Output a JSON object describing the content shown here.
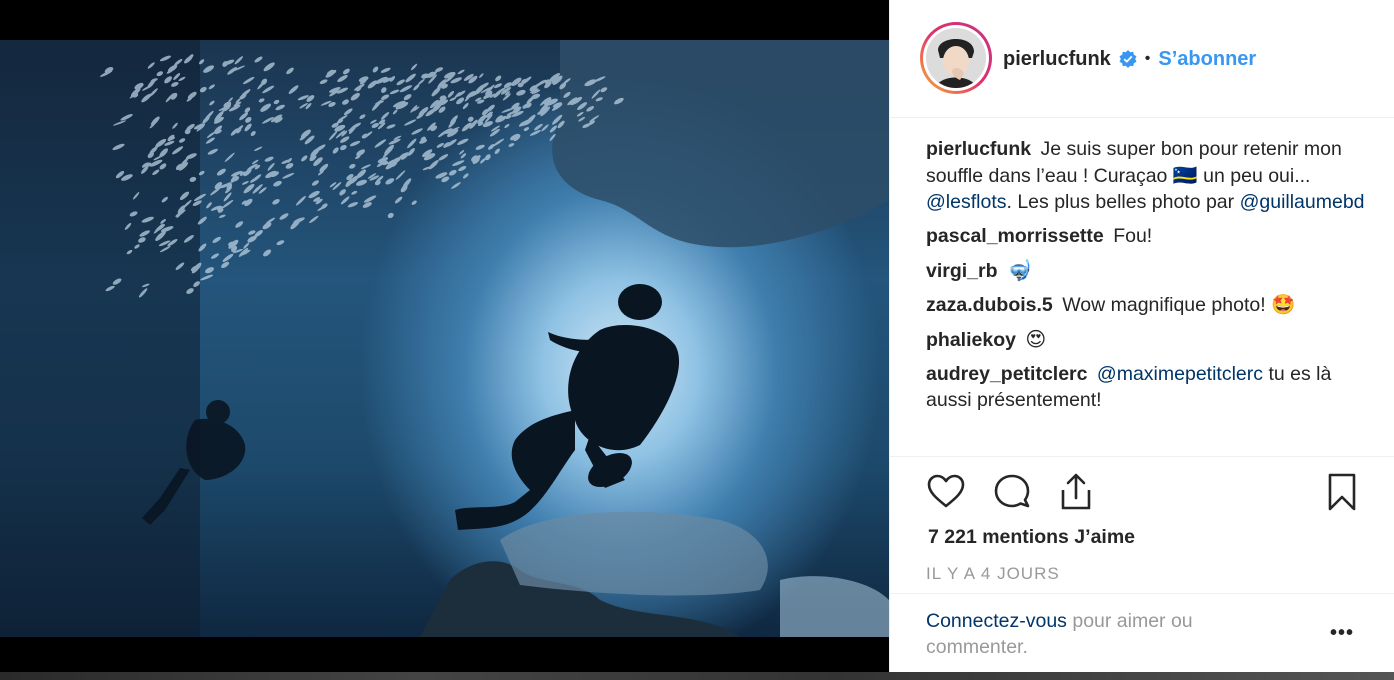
{
  "post": {
    "author": "pierlucfunk",
    "follow_label": "S’abonner",
    "dot": "•",
    "likes": "7 221 mentions J’aime",
    "time": "IL Y A 4 JOURS"
  },
  "caption": {
    "user": "pierlucfunk",
    "text_1": "Je suis super bon pour retenir mon souffle dans l’eau ! Curaçao",
    "flag_emoji": "🇨🇼",
    "text_2": "un peu oui...",
    "mention_1": "@lesflots",
    "text_3": ". Les plus belles photo par",
    "mention_2": "@guillaumebd"
  },
  "comments": [
    {
      "user": "pascal_morrissette",
      "text": "Fou!"
    },
    {
      "user": "virgi_rb",
      "text": "🤿"
    },
    {
      "user": "zaza.dubois.5",
      "text": "Wow magnifique photo! 🤩"
    },
    {
      "user": "phaliekoy",
      "text": "😍"
    },
    {
      "user": "audrey_petitclerc",
      "mention": "@maximepetitclerc",
      "text": "tu es là aussi présentement!"
    }
  ],
  "login": {
    "link": "Connectez-vous",
    "text": "pour aimer ou commenter."
  },
  "more_label": "•••",
  "icons": [
    "verified-icon",
    "heart-icon",
    "comment-icon",
    "share-icon",
    "bookmark-icon",
    "more-options-icon"
  ],
  "colors": {
    "link_blue": "#3897f0",
    "mention_navy": "#003569",
    "text": "#262626",
    "muted": "#999999"
  }
}
